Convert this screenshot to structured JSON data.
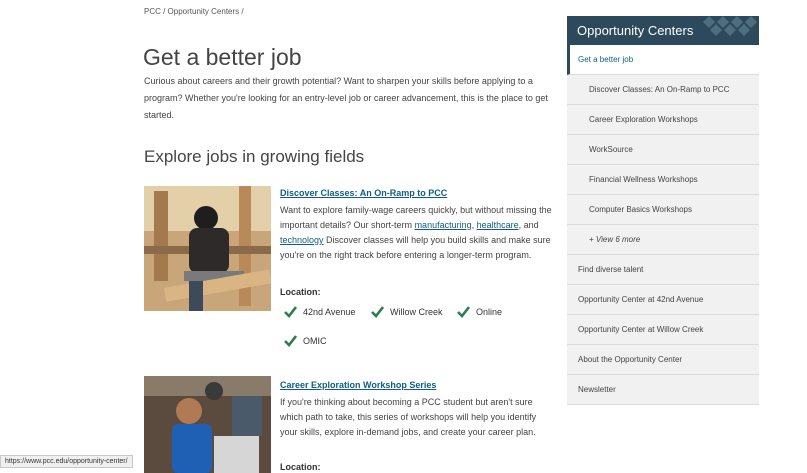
{
  "breadcrumb": "PCC / Opportunity Centers /",
  "page_title": "Get a better job",
  "intro": "Curious about careers and their growth potential? Want to sharpen your skills before applying to a program? Whether you're looking for an entry-level job or career advancement, this is the place to get started.",
  "section_heading": "Explore jobs in growing fields",
  "cards": [
    {
      "title": "Discover Classes: An On-Ramp to PCC",
      "body_before": "Want to explore family-wage careers quickly, but without missing the important details? Our short-term ",
      "link1": "manufacturing",
      "sep1": ", ",
      "link2": "healthcare",
      "sep2": ", and ",
      "link3": "technology",
      "body_after": " Discover classes will help you build skills and make sure you're on the right track before entering a longer-term program.",
      "location_label": "Location:",
      "locations": [
        "42nd Avenue",
        "Willow Creek",
        "Online",
        "OMIC"
      ]
    },
    {
      "title": "Career Exploration Workshop Series",
      "body": "If you're thinking about becoming a PCC student but aren't sure which path to take, this series of workshops will help you identify your skills, explore in-demand jobs, and create your career plan.",
      "location_label": "Location:"
    }
  ],
  "sidebar": {
    "title": "Opportunity Centers",
    "items": [
      {
        "label": "Get a better job"
      },
      {
        "label": "Discover Classes: An On-Ramp to PCC"
      },
      {
        "label": "Career Exploration Workshops"
      },
      {
        "label": "WorkSource"
      },
      {
        "label": "Financial Wellness Workshops"
      },
      {
        "label": "Computer Basics Workshops"
      },
      {
        "label": "+ View 6 more"
      },
      {
        "label": "Find diverse talent"
      },
      {
        "label": "Opportunity Center at 42nd Avenue"
      },
      {
        "label": "Opportunity Center at Willow Creek"
      },
      {
        "label": "About the Opportunity Center"
      },
      {
        "label": "Newsletter"
      }
    ]
  },
  "status_url": "https://www.pcc.edu/opportunity-center/",
  "colors": {
    "link": "#0f5e83",
    "sidebar_header": "#2d4a5c",
    "check": "#2e7d4f"
  }
}
